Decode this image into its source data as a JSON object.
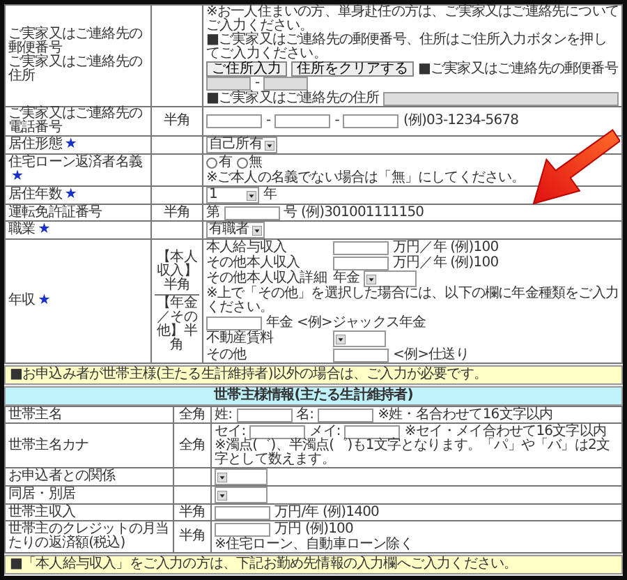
{
  "applicant_rows": [
    {
      "labels": [
        "ご実家又はご連絡先の郵便番号",
        "ご実家又はご連絡先の住所"
      ],
      "lines": [
        [
          {
            "kind": "text",
            "text": "※お一人住まいの方、単身赴任の方は、ご実家又はご連絡先についてご入力ください。"
          }
        ],
        [
          {
            "kind": "text",
            "text": "■ご実家又はご連絡先の郵便番号、住所はご住所入力ボタンを押してご入力ください。"
          }
        ],
        [
          {
            "kind": "button",
            "text": "ご住所入力"
          },
          {
            "kind": "button",
            "text": "住所をクリアする"
          },
          {
            "kind": "text",
            "text": "■ご実家又はご連絡先の郵便番号"
          },
          {
            "kind": "short_input",
            "disabled": true
          },
          {
            "kind": "text",
            "text": "-"
          },
          {
            "kind": "short_input",
            "disabled": true
          }
        ],
        [
          {
            "kind": "text",
            "text": "■ご実家又はご連絡先の住所"
          },
          {
            "kind": "long_input",
            "disabled": true
          }
        ]
      ]
    },
    {
      "label": "ご実家又はご連絡先の電話番号",
      "input_type": "半角",
      "lines": [
        [
          {
            "kind": "input",
            "disabled": false
          },
          {
            "kind": "text",
            "text": "-"
          },
          {
            "kind": "input",
            "disabled": false
          },
          {
            "kind": "text",
            "text": "-"
          },
          {
            "kind": "input",
            "disabled": false
          },
          {
            "kind": "text",
            "text": "(例)03-1234-5678"
          }
        ]
      ]
    },
    {
      "label": "居住形態",
      "mark": "★",
      "lines": [
        [
          {
            "kind": "select",
            "value": "自己所有"
          }
        ]
      ]
    },
    {
      "label": "住宅ローン返済者名義",
      "mark": "★",
      "lines": [
        [
          {
            "kind": "radio",
            "text": "有",
            "selected": false
          },
          {
            "kind": "radio",
            "text": "無",
            "selected": false
          }
        ],
        [
          {
            "kind": "text",
            "text": "※ご本人の名義でない場合は「無」にしてください。"
          }
        ]
      ]
    },
    {
      "label": "居住年数",
      "mark": "★",
      "lines": [
        [
          {
            "kind": "select",
            "value": "1"
          },
          {
            "kind": "text",
            "text": "年"
          }
        ]
      ]
    },
    {
      "label": "運転免許証番号",
      "input_type": "半角",
      "lines": [
        [
          {
            "kind": "text",
            "text": "第"
          },
          {
            "kind": "input",
            "disabled": false
          },
          {
            "kind": "text",
            "text": "号 (例)301001111150"
          }
        ]
      ]
    },
    {
      "label": "職業",
      "mark": "★",
      "lines": [
        [
          {
            "kind": "select",
            "value": "有職者"
          }
        ]
      ]
    },
    {
      "label": "年収",
      "mark": "★",
      "input_types": [
        "【本人収入】半角",
        "【年金／その他】半角"
      ],
      "lines": [
        [
          {
            "kind": "field_label",
            "text": "本人給与収入"
          },
          {
            "kind": "input",
            "disabled": false
          },
          {
            "kind": "text",
            "text": "万円／年 (例)100"
          }
        ],
        [
          {
            "kind": "field_label",
            "text": "その他本人収入"
          },
          {
            "kind": "input",
            "disabled": false
          },
          {
            "kind": "text",
            "text": "万円／年 (例)100"
          }
        ],
        [
          {
            "kind": "field_label",
            "text": "その他本人収入詳細"
          },
          {
            "kind": "text",
            "text": "年金"
          },
          {
            "kind": "select"
          }
        ],
        [
          {
            "kind": "text",
            "text": "※上で「その他」を選択した場合には、以下の欄に年金種類をご入力ください。"
          }
        ],
        [
          {
            "kind": "input",
            "disabled": false
          },
          {
            "kind": "text",
            "text": "年金 <例>ジャックス年金"
          }
        ],
        [
          {
            "kind": "field_label",
            "text": "不動産賃料"
          },
          {
            "kind": "select"
          }
        ],
        [
          {
            "kind": "field_label",
            "text": "その他"
          },
          {
            "kind": "input",
            "disabled": false
          },
          {
            "kind": "text",
            "text": "<例>仕送り"
          }
        ]
      ]
    }
  ],
  "notice_top": "■お申込み者が世帯主様(主たる生計維持者)以外の場合は、ご入力が必要です。",
  "household": {
    "title": "世帯主様情報(主たる生計維持者)",
    "rows": [
      {
        "label": "世帯主名",
        "input_type": "全角",
        "lines": [
          [
            {
              "kind": "text",
              "text": "姓:"
            },
            {
              "kind": "input",
              "disabled": false
            },
            {
              "kind": "text",
              "text": "名:"
            },
            {
              "kind": "input",
              "disabled": false
            },
            {
              "kind": "text",
              "text": "※姓・名合わせて16文字以内"
            }
          ]
        ]
      },
      {
        "label": "世帯主名カナ",
        "input_type": "全角",
        "lines": [
          [
            {
              "kind": "text",
              "text": "セイ:"
            },
            {
              "kind": "input",
              "disabled": false
            },
            {
              "kind": "text",
              "text": "メイ:"
            },
            {
              "kind": "input",
              "disabled": false
            },
            {
              "kind": "text",
              "text": "※セイ・メイ合わせて16文字以内"
            }
          ],
          [
            {
              "kind": "text",
              "text": "※濁点(゛)、半濁点(゜)も1文字となります。「パ」や「バ」は2文字として数えます。"
            }
          ]
        ]
      },
      {
        "label": "お申込者との関係",
        "lines": [
          [
            {
              "kind": "select"
            }
          ]
        ]
      },
      {
        "label": "同居・別居",
        "lines": [
          [
            {
              "kind": "select"
            }
          ]
        ]
      },
      {
        "label": "世帯主収入",
        "input_type": "半角",
        "lines": [
          [
            {
              "kind": "input",
              "disabled": false
            },
            {
              "kind": "text",
              "text": "万円/年 (例)1400"
            }
          ]
        ]
      },
      {
        "label": "世帯主のクレジットの月当たりの返済額(税込)",
        "input_type": "半角",
        "lines": [
          [
            {
              "kind": "input",
              "disabled": false
            },
            {
              "kind": "text",
              "text": "万円 (例)100"
            }
          ],
          [
            {
              "kind": "text",
              "text": "※住宅ローン、自動車ローン除く"
            }
          ]
        ]
      }
    ]
  },
  "notice_bottom": "■「本人給与収入」をご入力の方は、下記お勤め先情報の入力欄へご入力ください。"
}
